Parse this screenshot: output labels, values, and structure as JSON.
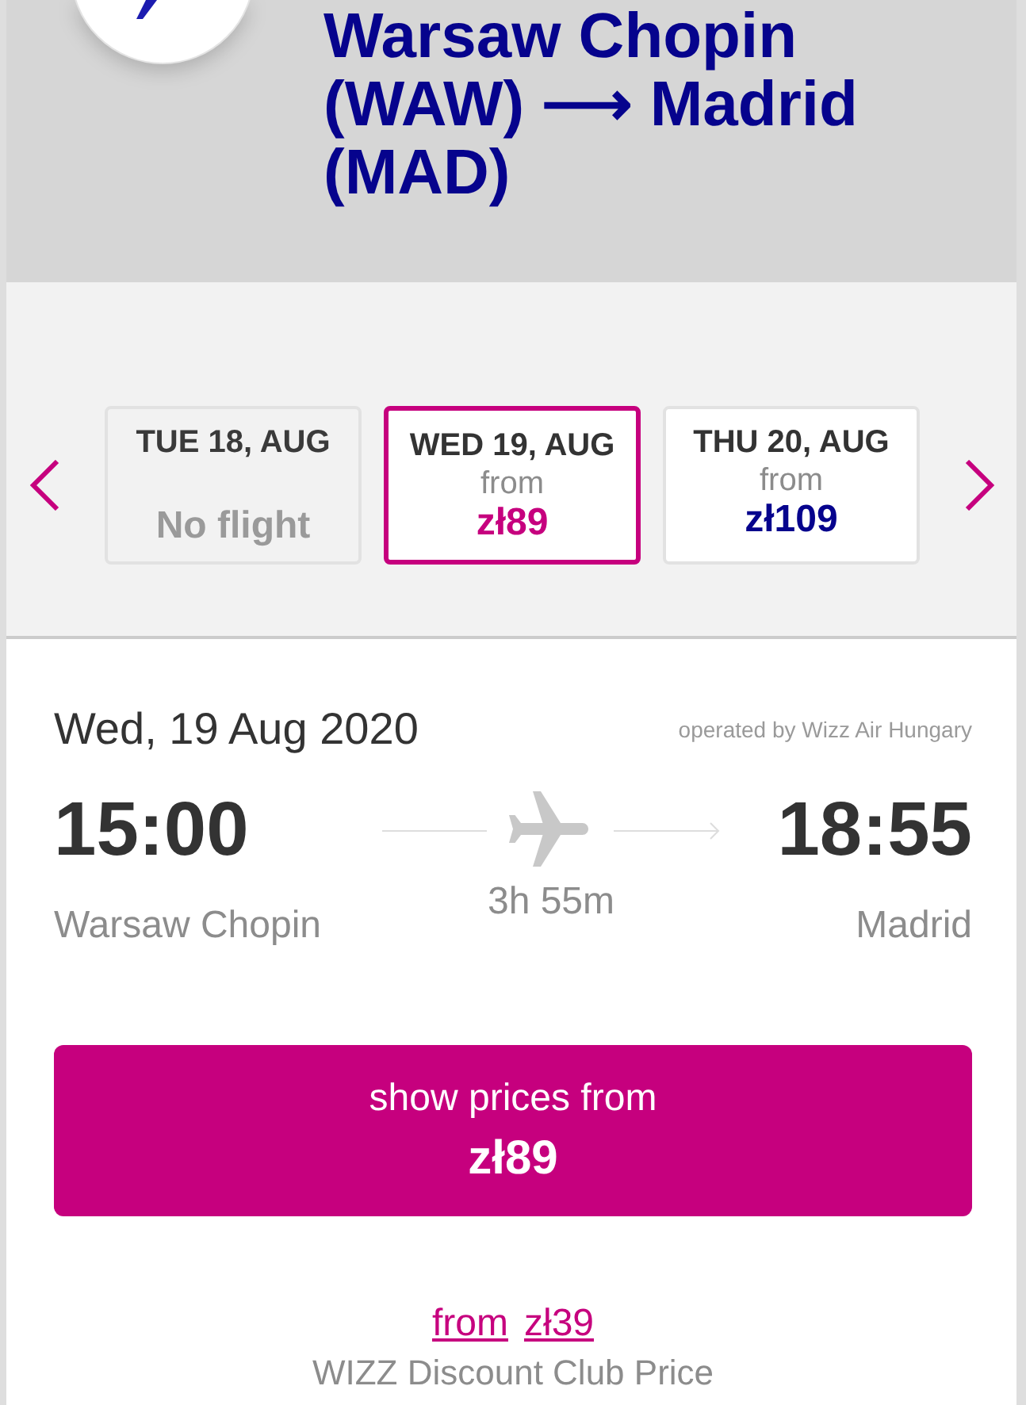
{
  "header": {
    "title": "Warsaw Chopin (WAW) ⟶ Madrid (MAD)"
  },
  "dates": [
    {
      "day": "TUE 18, AUG",
      "note": "No flight",
      "disabled": true,
      "selected": false
    },
    {
      "day": "WED 19, AUG",
      "from": "from",
      "price": "zł89",
      "disabled": false,
      "selected": true
    },
    {
      "day": "THU 20, AUG",
      "from": "from",
      "price": "zł109",
      "disabled": false,
      "selected": false
    }
  ],
  "flight": {
    "date": "Wed, 19 Aug 2020",
    "operator": "operated by Wizz Air Hungary",
    "departure": {
      "time": "15:00",
      "airport": "Warsaw Chopin"
    },
    "duration": "3h 55m",
    "arrival": {
      "time": "18:55",
      "airport": "Madrid"
    }
  },
  "cta": {
    "label": "show prices from",
    "price": "zł89"
  },
  "club_price": {
    "from": "from",
    "price": "zł39",
    "caption": "WIZZ Discount Club Price"
  }
}
